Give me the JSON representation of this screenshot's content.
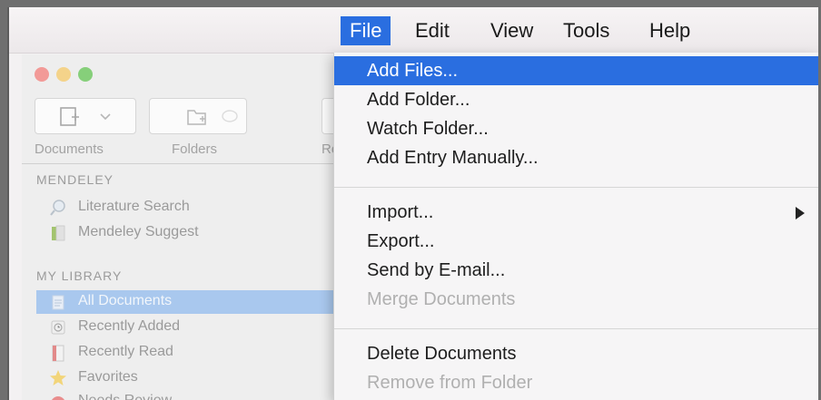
{
  "menubar": {
    "items": [
      {
        "label": "File",
        "active": true
      },
      {
        "label": "Edit"
      },
      {
        "label": "View"
      },
      {
        "label": "Tools"
      },
      {
        "label": "Help"
      }
    ]
  },
  "toolbar": {
    "documents_label": "Documents",
    "folders_label": "Folders",
    "third_label_partial": "Re"
  },
  "sidebar": {
    "mendeley_header": "MENDELEY",
    "mendeley_items": [
      {
        "label": "Literature Search",
        "icon": "search-icon"
      },
      {
        "label": "Mendeley Suggest",
        "icon": "suggest-icon"
      }
    ],
    "library_header": "MY LIBRARY",
    "library_items": [
      {
        "label": "All Documents",
        "icon": "documents-icon",
        "selected": true
      },
      {
        "label": "Recently Added",
        "icon": "clock-icon"
      },
      {
        "label": "Recently Read",
        "icon": "book-icon"
      },
      {
        "label": "Favorites",
        "icon": "star-icon"
      },
      {
        "label": "Needs Review",
        "icon": "review-icon"
      }
    ]
  },
  "file_menu": {
    "items": [
      {
        "label": "Add Files...",
        "highlighted": true
      },
      {
        "label": "Add Folder..."
      },
      {
        "label": "Watch Folder..."
      },
      {
        "label": "Add Entry Manually..."
      },
      {
        "label": "Import...",
        "submenu": true
      },
      {
        "label": "Export..."
      },
      {
        "label": "Send by E-mail..."
      },
      {
        "label": "Merge Documents",
        "disabled": true
      },
      {
        "label": "Delete Documents"
      },
      {
        "label": "Remove from Folder",
        "disabled": true
      }
    ]
  },
  "colors": {
    "accent": "#2a6ee0",
    "selection": "#a9c8ee",
    "disabled_text": "#b0b0b0"
  }
}
